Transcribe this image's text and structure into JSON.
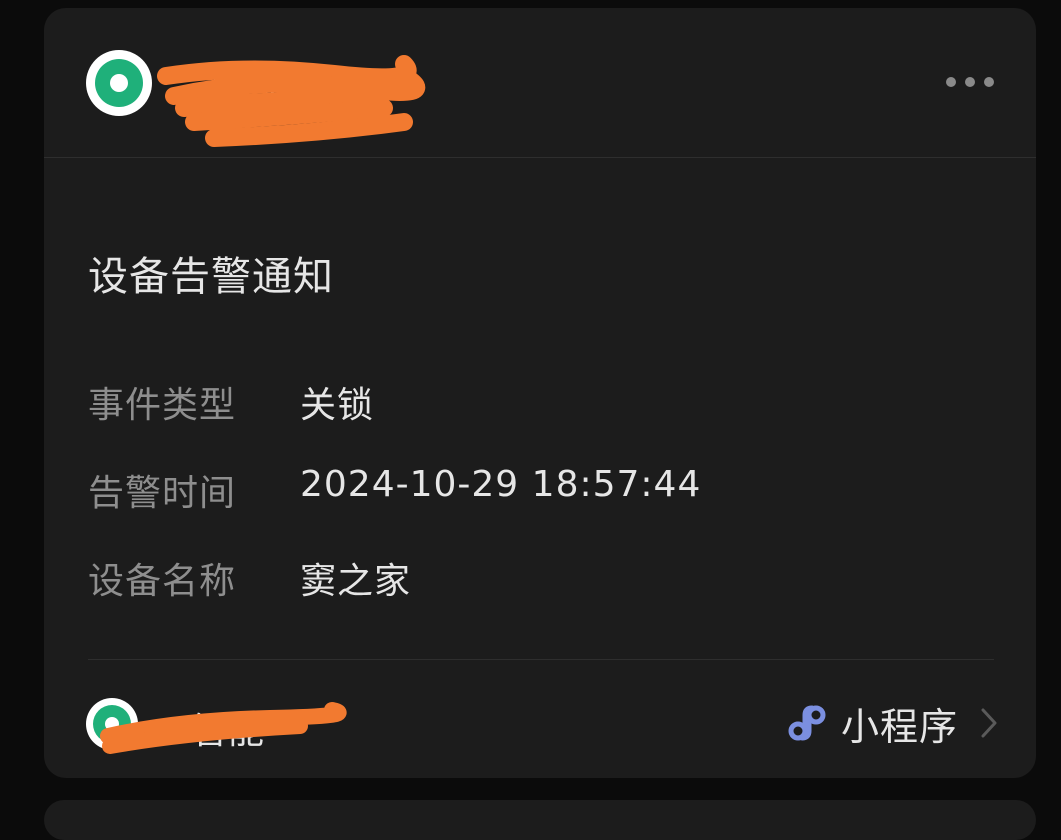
{
  "account": {
    "name": "…智能",
    "redacted": true
  },
  "menu": {
    "more_icon": "more-dots-icon"
  },
  "notification": {
    "title": "设备告警通知",
    "fields": [
      {
        "label": "事件类型",
        "value": "关锁"
      },
      {
        "label": "告警时间",
        "value": "2024-10-29 18:57:44"
      },
      {
        "label": "设备名称",
        "value": "窦之家"
      }
    ]
  },
  "footer": {
    "source_name": "…智能",
    "mini_program_label": "小程序",
    "mini_program_icon": "link-icon",
    "chevron_icon": "chevron-right-icon"
  },
  "colors": {
    "background": "#0b0b0b",
    "card": "#1c1c1c",
    "brand": "#1fb07a",
    "redaction": "#f27a30",
    "mini_program_icon": "#7b8fe0"
  }
}
